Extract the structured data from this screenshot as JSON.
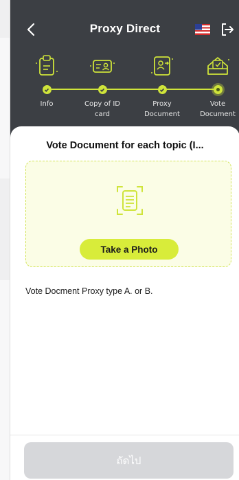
{
  "header": {
    "title": "Proxy Direct"
  },
  "stepper": {
    "steps": [
      {
        "label": "Info",
        "status": "done"
      },
      {
        "label": "Copy of ID card",
        "status": "done"
      },
      {
        "label": "Proxy\nDocument",
        "status": "done"
      },
      {
        "label": "Vote\nDocument",
        "status": "current"
      }
    ]
  },
  "sheet": {
    "title": "Vote Document for each topic (I...",
    "photo_button_label": "Take a Photo",
    "description": "Vote Docment Proxy type A. or B."
  },
  "footer": {
    "next_label": "ถัดไป"
  },
  "colors": {
    "header_bg": "#3c3f44",
    "accent": "#d8ec3a",
    "upload_bg": "#fbfde6",
    "disabled_button": "#d6d7da"
  },
  "icons": {
    "back": "chevron-left-icon",
    "language": "us-flag-icon",
    "logout": "logout-icon",
    "scan": "document-scan-icon"
  }
}
